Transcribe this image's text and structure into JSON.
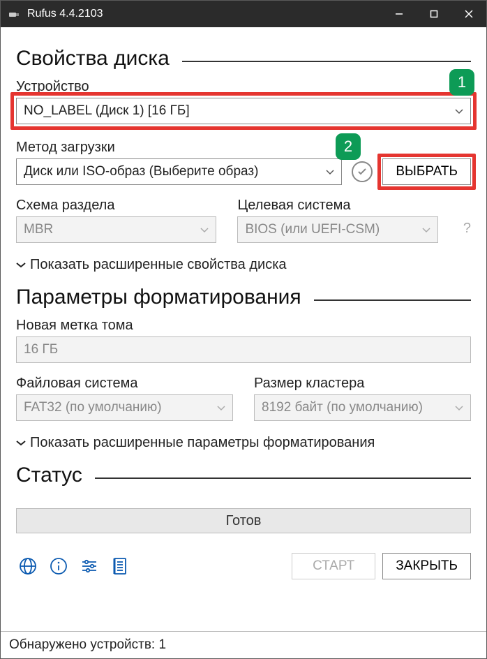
{
  "window": {
    "title": "Rufus 4.4.2103"
  },
  "sections": {
    "drive_props": "Свойства диска",
    "format_opts": "Параметры форматирования",
    "status": "Статус"
  },
  "badges": {
    "one": "1",
    "two": "2"
  },
  "device": {
    "label": "Устройство",
    "value": "NO_LABEL (Диск 1) [16 ГБ]"
  },
  "boot": {
    "label": "Метод загрузки",
    "value": "Диск или ISO-образ (Выберите образ)",
    "browse": "ВЫБРАТЬ"
  },
  "partition": {
    "label": "Схема раздела",
    "value": "MBR"
  },
  "target": {
    "label": "Целевая система",
    "value": "BIOS (или UEFI-CSM)"
  },
  "adv_drive": "Показать расширенные свойства диска",
  "volume": {
    "label": "Новая метка тома",
    "value": "16 ГБ"
  },
  "filesystem": {
    "label": "Файловая система",
    "value": "FAT32 (по умолчанию)"
  },
  "cluster": {
    "label": "Размер кластера",
    "value": "8192 байт (по умолчанию)"
  },
  "adv_format": "Показать расширенные параметры форматирования",
  "status_text": "Готов",
  "buttons": {
    "start": "СТАРТ",
    "close": "ЗАКРЫТЬ"
  },
  "statusline": "Обнаружено устройств: 1",
  "icons": {
    "lang": "globe-icon",
    "info": "info-icon",
    "settings": "settings-icon",
    "log": "log-icon"
  }
}
